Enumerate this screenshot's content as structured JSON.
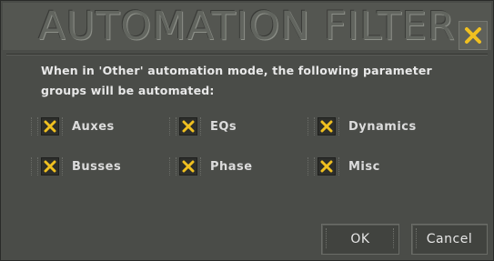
{
  "dialog": {
    "title": "AUTOMATION FILTER",
    "description": "When in 'Other' automation mode, the following parameter groups will be automated:"
  },
  "options": [
    {
      "label": "Auxes",
      "checked": true
    },
    {
      "label": "EQs",
      "checked": true
    },
    {
      "label": "Dynamics",
      "checked": true
    },
    {
      "label": "Busses",
      "checked": true
    },
    {
      "label": "Phase",
      "checked": true
    },
    {
      "label": "Misc",
      "checked": true
    }
  ],
  "buttons": {
    "ok_label": "OK",
    "cancel_label": "Cancel"
  },
  "colors": {
    "background": "#4a4c48",
    "check_accent": "#f0c020"
  }
}
